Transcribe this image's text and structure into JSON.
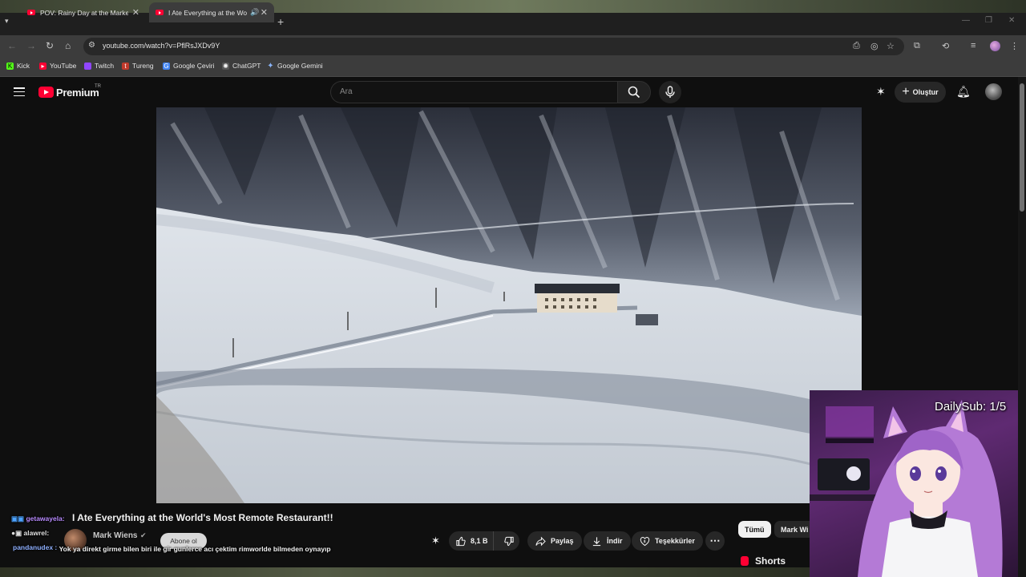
{
  "browser": {
    "tabs": [
      {
        "title": "POV: Rainy Day at the Market -",
        "active": false
      },
      {
        "title": "I Ate Everything at the Worl",
        "active": true
      }
    ],
    "url": "youtube.com/watch?v=PflRsJXDv9Y",
    "bookmarks": [
      {
        "label": "Kick",
        "icon": "kick-icon",
        "color": "#53fc18"
      },
      {
        "label": "YouTube",
        "icon": "youtube-icon",
        "color": "#ff0033"
      },
      {
        "label": "Twitch",
        "icon": "twitch-icon",
        "color": "#9146ff"
      },
      {
        "label": "Tureng",
        "icon": "tureng-icon",
        "color": "#c0392b"
      },
      {
        "label": "Google Çeviri",
        "icon": "translate-icon",
        "color": "#4285f4"
      },
      {
        "label": "ChatGPT",
        "icon": "chatgpt-icon",
        "color": "#cccccc"
      },
      {
        "label": "Google Gemini",
        "icon": "gemini-icon",
        "color": "#8ab4f8"
      }
    ]
  },
  "youtube": {
    "brand": "Premium",
    "region": "TR",
    "search_placeholder": "Ara",
    "create_label": "Oluştur",
    "accent": "#ff0033"
  },
  "video": {
    "title": "I Ate Everything at the World's Most Remote Restaurant!!",
    "channel": "Mark Wiens",
    "subscribe_label": "Abone ol",
    "likes": "8,1 B",
    "share_label": "Paylaş",
    "download_label": "İndir",
    "thanks_label": "Teşekkürler"
  },
  "sidebar": {
    "chips": [
      "Tümü",
      "Mark Wi"
    ],
    "shorts_label": "Shorts"
  },
  "chat": [
    {
      "user": "getawayela",
      "user_color": "#b98cff",
      "text": ""
    },
    {
      "user": "alawrel",
      "user_color": "#e0e0e0",
      "text": ""
    },
    {
      "user": "pandanudex",
      "user_color": "#8fb0ff",
      "text": "Yok ya direkt girme bilen biri ile gir gunlerce acı çektim rimworlde bilmeden oynayıp"
    }
  ],
  "overlay": {
    "daily_sub": "DailySub: 1/5"
  }
}
